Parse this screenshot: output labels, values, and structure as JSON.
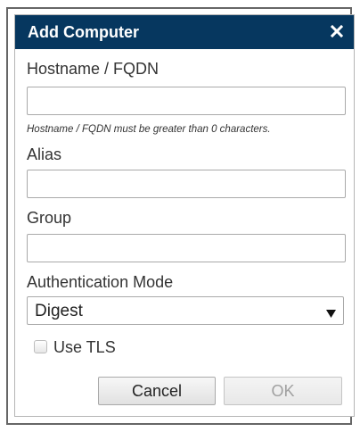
{
  "dialog": {
    "title": "Add Computer",
    "close_icon": "close-icon"
  },
  "fields": {
    "hostname": {
      "label": "Hostname / FQDN",
      "value": "",
      "validation_message": "Hostname / FQDN must be greater than 0 characters."
    },
    "alias": {
      "label": "Alias",
      "value": ""
    },
    "group": {
      "label": "Group",
      "value": ""
    },
    "auth_mode": {
      "label": "Authentication Mode",
      "selected": "Digest",
      "arrow_icon": "triangle-down-icon"
    },
    "use_tls": {
      "label": "Use TLS",
      "checked": false
    }
  },
  "buttons": {
    "cancel_label": "Cancel",
    "ok_label": "OK",
    "ok_enabled": false
  },
  "colors": {
    "titlebar": "#06375f",
    "title_text": "#ffffff",
    "disabled_text": "#a0a0a0"
  }
}
